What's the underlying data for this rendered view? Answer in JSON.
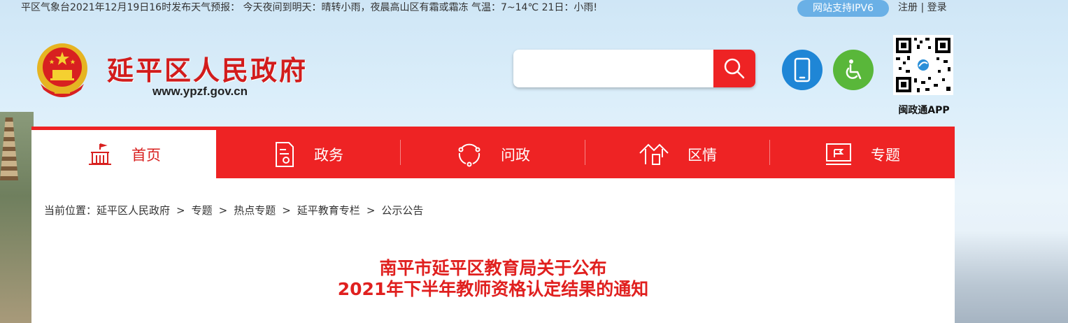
{
  "topbar": {
    "weather": "平区气象台2021年12月19日16时发布天气预报： 今天夜间到明天：晴转小雨，夜晨高山区有霜或霜冻 气温：7~14℃ 21日：小雨!",
    "ipv6_badge": "网站支持IPV6",
    "register": "注册",
    "divider": "|",
    "login": "登录"
  },
  "header": {
    "site_title": "延平区人民政府",
    "site_url": "www.ypzf.gov.cn",
    "search": {
      "placeholder": ""
    },
    "qr_label": "闽政通APP"
  },
  "nav": {
    "items": [
      {
        "label": "首页",
        "icon": "home-building-icon",
        "active": true
      },
      {
        "label": "政务",
        "icon": "document-icon",
        "active": false
      },
      {
        "label": "问政",
        "icon": "chat-cycle-icon",
        "active": false
      },
      {
        "label": "区情",
        "icon": "landscape-icon",
        "active": false
      },
      {
        "label": "专题",
        "icon": "monitor-flag-icon",
        "active": false
      }
    ]
  },
  "breadcrumb": {
    "prefix": "当前位置：",
    "items": [
      "延平区人民政府",
      "专题",
      "热点专题",
      "延平教育专栏",
      "公示公告"
    ],
    "separator": ">"
  },
  "article": {
    "title_line1": "南平市延平区教育局关于公布",
    "title_line2": "2021年下半年教师资格认定结果的通知"
  },
  "colors": {
    "brand_red": "#ee2324",
    "title_red": "#e0201f",
    "ipv6_blue": "#6ab0e6",
    "mobile_blue": "#1f86d6",
    "access_green": "#59b73a"
  }
}
